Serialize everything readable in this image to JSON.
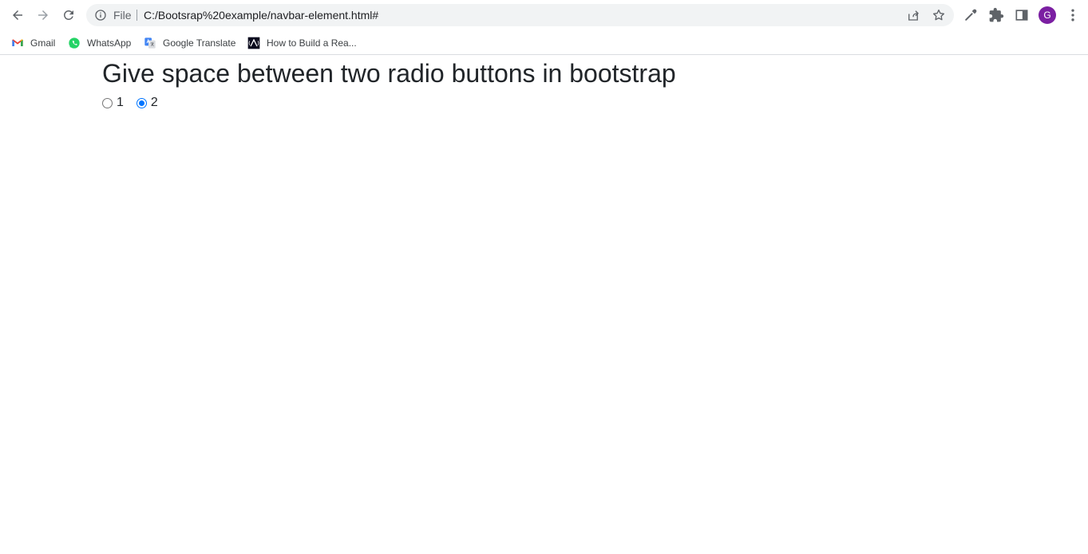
{
  "browser": {
    "url_scheme_label": "File",
    "url": "C:/Bootsrap%20example/navbar-element.html#",
    "profile_initial": "G",
    "profile_color": "#7b1fa2"
  },
  "bookmarks": [
    {
      "label": "Gmail",
      "icon": "gmail-icon"
    },
    {
      "label": "WhatsApp",
      "icon": "whatsapp-icon"
    },
    {
      "label": "Google Translate",
      "icon": "google-translate-icon"
    },
    {
      "label": "How to Build a Rea...",
      "icon": "site-logo-icon"
    }
  ],
  "page": {
    "title": "Give space between two radio buttons in bootstrap",
    "radios": [
      {
        "label": "1",
        "checked": false
      },
      {
        "label": "2",
        "checked": true
      }
    ],
    "accent_color": "#0075ff",
    "text_color": "#212529"
  }
}
